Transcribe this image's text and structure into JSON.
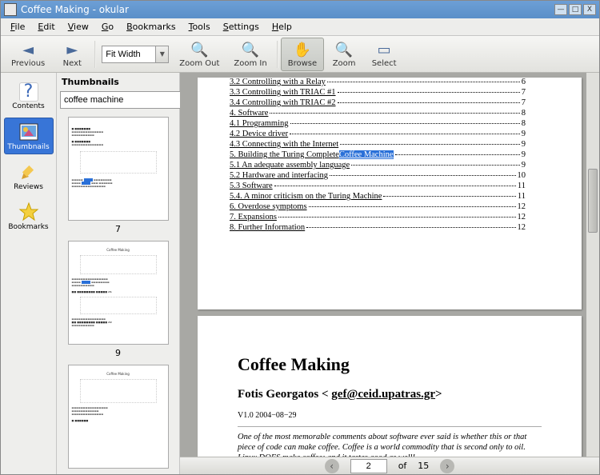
{
  "window": {
    "title": "Coffee Making - okular",
    "min": "—",
    "max": "□",
    "close": "X"
  },
  "menu": {
    "file": "File",
    "edit": "Edit",
    "view": "View",
    "go": "Go",
    "bookmarks": "Bookmarks",
    "tools": "Tools",
    "settings": "Settings",
    "help": "Help"
  },
  "toolbar": {
    "previous": "Previous",
    "next": "Next",
    "zoom_value": "Fit Width",
    "zoom_out": "Zoom Out",
    "zoom_in": "Zoom In",
    "browse": "Browse",
    "zoom": "Zoom",
    "select": "Select"
  },
  "side": {
    "contents": "Contents",
    "thumbnails": "Thumbnails",
    "reviews": "Reviews",
    "bookmarks": "Bookmarks"
  },
  "thumbpanel": {
    "heading": "Thumbnails",
    "search_value": "coffee machine",
    "page_a": "7",
    "page_b": "9"
  },
  "toc": [
    {
      "t": "3.2 Controlling with a Relay",
      "p": "6",
      "hl": ""
    },
    {
      "t": "3.3 Controlling with TRIAC #1",
      "p": "7",
      "hl": ""
    },
    {
      "t": "3.4 Controlling with TRIAC #2",
      "p": "7",
      "hl": ""
    },
    {
      "t": "4. Software",
      "p": "8",
      "hl": ""
    },
    {
      "t": "4.1 Programming",
      "p": "8",
      "hl": ""
    },
    {
      "t": "4.2 Device driver",
      "p": "9",
      "hl": ""
    },
    {
      "t": "4.3 Connecting with the Internet",
      "p": "9",
      "hl": ""
    },
    {
      "t": "5. Building the Turing Complete ",
      "p": "9",
      "hl": "Coffee Machine"
    },
    {
      "t": "5.1 An adequate assembly language",
      "p": "9",
      "hl": ""
    },
    {
      "t": "5.2 Hardware and interfacing",
      "p": "10",
      "hl": ""
    },
    {
      "t": "5.3 Software",
      "p": "11",
      "hl": ""
    },
    {
      "t": "5.4. A minor criticism on the Turing Machine",
      "p": "11",
      "hl": ""
    },
    {
      "t": "6. Overdose symptoms",
      "p": "12",
      "hl": ""
    },
    {
      "t": "7. Expansions",
      "p": "12",
      "hl": ""
    },
    {
      "t": "8. Further Information",
      "p": "12",
      "hl": ""
    }
  ],
  "doc": {
    "title": "Coffee Making",
    "author_pre": "Fotis Georgatos < ",
    "email": "gef@ceid.upatras.gr",
    "author_post": ">",
    "version": "V1.0  2004−08−29",
    "intro": "One of the most memorable comments about software ever said is whether this or that piece of code can make coffee. Coffee is a world commodity that is second only to oil. Linux DOES make coffee; and it tastes good as well!"
  },
  "nav": {
    "current": "2",
    "of": "of",
    "total": "15"
  }
}
